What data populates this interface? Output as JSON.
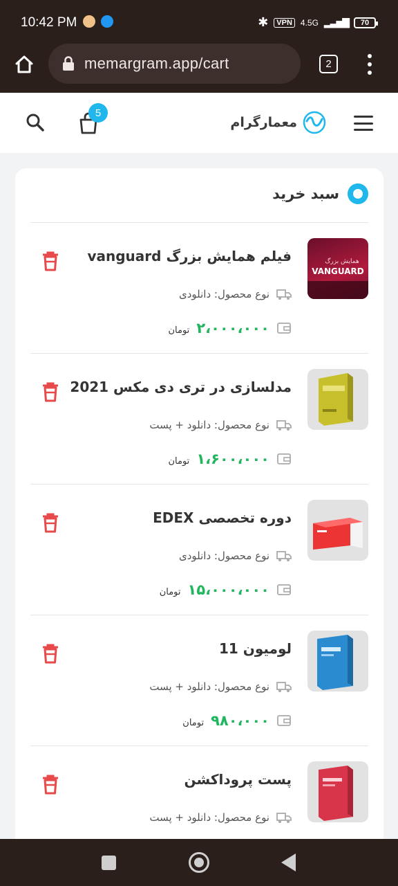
{
  "status_bar": {
    "time": "10:42 PM",
    "vpn": "VPN",
    "network": "4.5G",
    "battery": "70"
  },
  "browser": {
    "url": "memargram.app/cart",
    "tab_count": "2"
  },
  "site": {
    "brand_name": "معمارگرام",
    "cart_count": "5"
  },
  "cart": {
    "title": "سبد خرید",
    "items": [
      {
        "title": "فیلم همایش بزرگ vanguard",
        "type": "نوع محصول: دانلودی",
        "price": "۲،۰۰۰،۰۰۰",
        "currency": "تومان",
        "thumb_text": "VANGUARD",
        "thumb_sub": "همایش بزرگ"
      },
      {
        "title": "مدلسازی در تری دی مکس 2021",
        "type": "نوع محصول: دانلود + پست",
        "price": "۱،۶۰۰،۰۰۰",
        "currency": "تومان"
      },
      {
        "title": "دوره تخصصی EDEX",
        "type": "نوع محصول: دانلودی",
        "price": "۱۵،۰۰۰،۰۰۰",
        "currency": "تومان"
      },
      {
        "title": "لومیون 11",
        "type": "نوع محصول: دانلود + پست",
        "price": "۹۸۰،۰۰۰",
        "currency": "تومان"
      },
      {
        "title": "پست پروداکشن",
        "type": "نوع محصول: دانلود + پست",
        "price": "",
        "currency": ""
      }
    ]
  },
  "colors": {
    "accent": "#1fb7ec",
    "price": "#20b65e",
    "delete": "#e64a4a",
    "chrome": "#2b1f1c"
  }
}
